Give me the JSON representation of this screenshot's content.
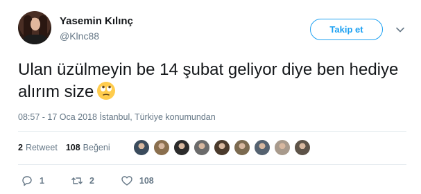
{
  "user": {
    "name": "Yasemin Kılınç",
    "handle": "@Klnc88"
  },
  "follow_button": {
    "label": "Takip et"
  },
  "tweet": {
    "text": "Ulan üzülmeyin be 14 şubat geliyor diye ben hediye alırım size",
    "emoji": "rolling-eyes-emoji"
  },
  "timestamp": "08:57 - 17 Oca 2018 İstanbul, Türkiye konumundan",
  "stats": {
    "retweets_count": "2",
    "retweets_label": "Retweet",
    "likes_count": "108",
    "likes_label": "Beğeni"
  },
  "likers": [
    {
      "name": "liker-avatar-1",
      "color": "#3a4b5c"
    },
    {
      "name": "liker-avatar-2",
      "color": "#8a6f4e"
    },
    {
      "name": "liker-avatar-3",
      "color": "#2b2b2b"
    },
    {
      "name": "liker-avatar-4",
      "color": "#6b6b6b"
    },
    {
      "name": "liker-avatar-5",
      "color": "#4a3a2c"
    },
    {
      "name": "liker-avatar-6",
      "color": "#7b6a50"
    },
    {
      "name": "liker-avatar-7",
      "color": "#556270"
    },
    {
      "name": "liker-avatar-8",
      "color": "#a89a8c"
    },
    {
      "name": "liker-avatar-9",
      "color": "#5d5348"
    }
  ],
  "actions": {
    "reply_count": "1",
    "retweet_count": "2",
    "like_count": "108"
  },
  "colors": {
    "accent": "#1da1f2",
    "secondary_text": "#657786",
    "primary_text": "#14171a"
  }
}
